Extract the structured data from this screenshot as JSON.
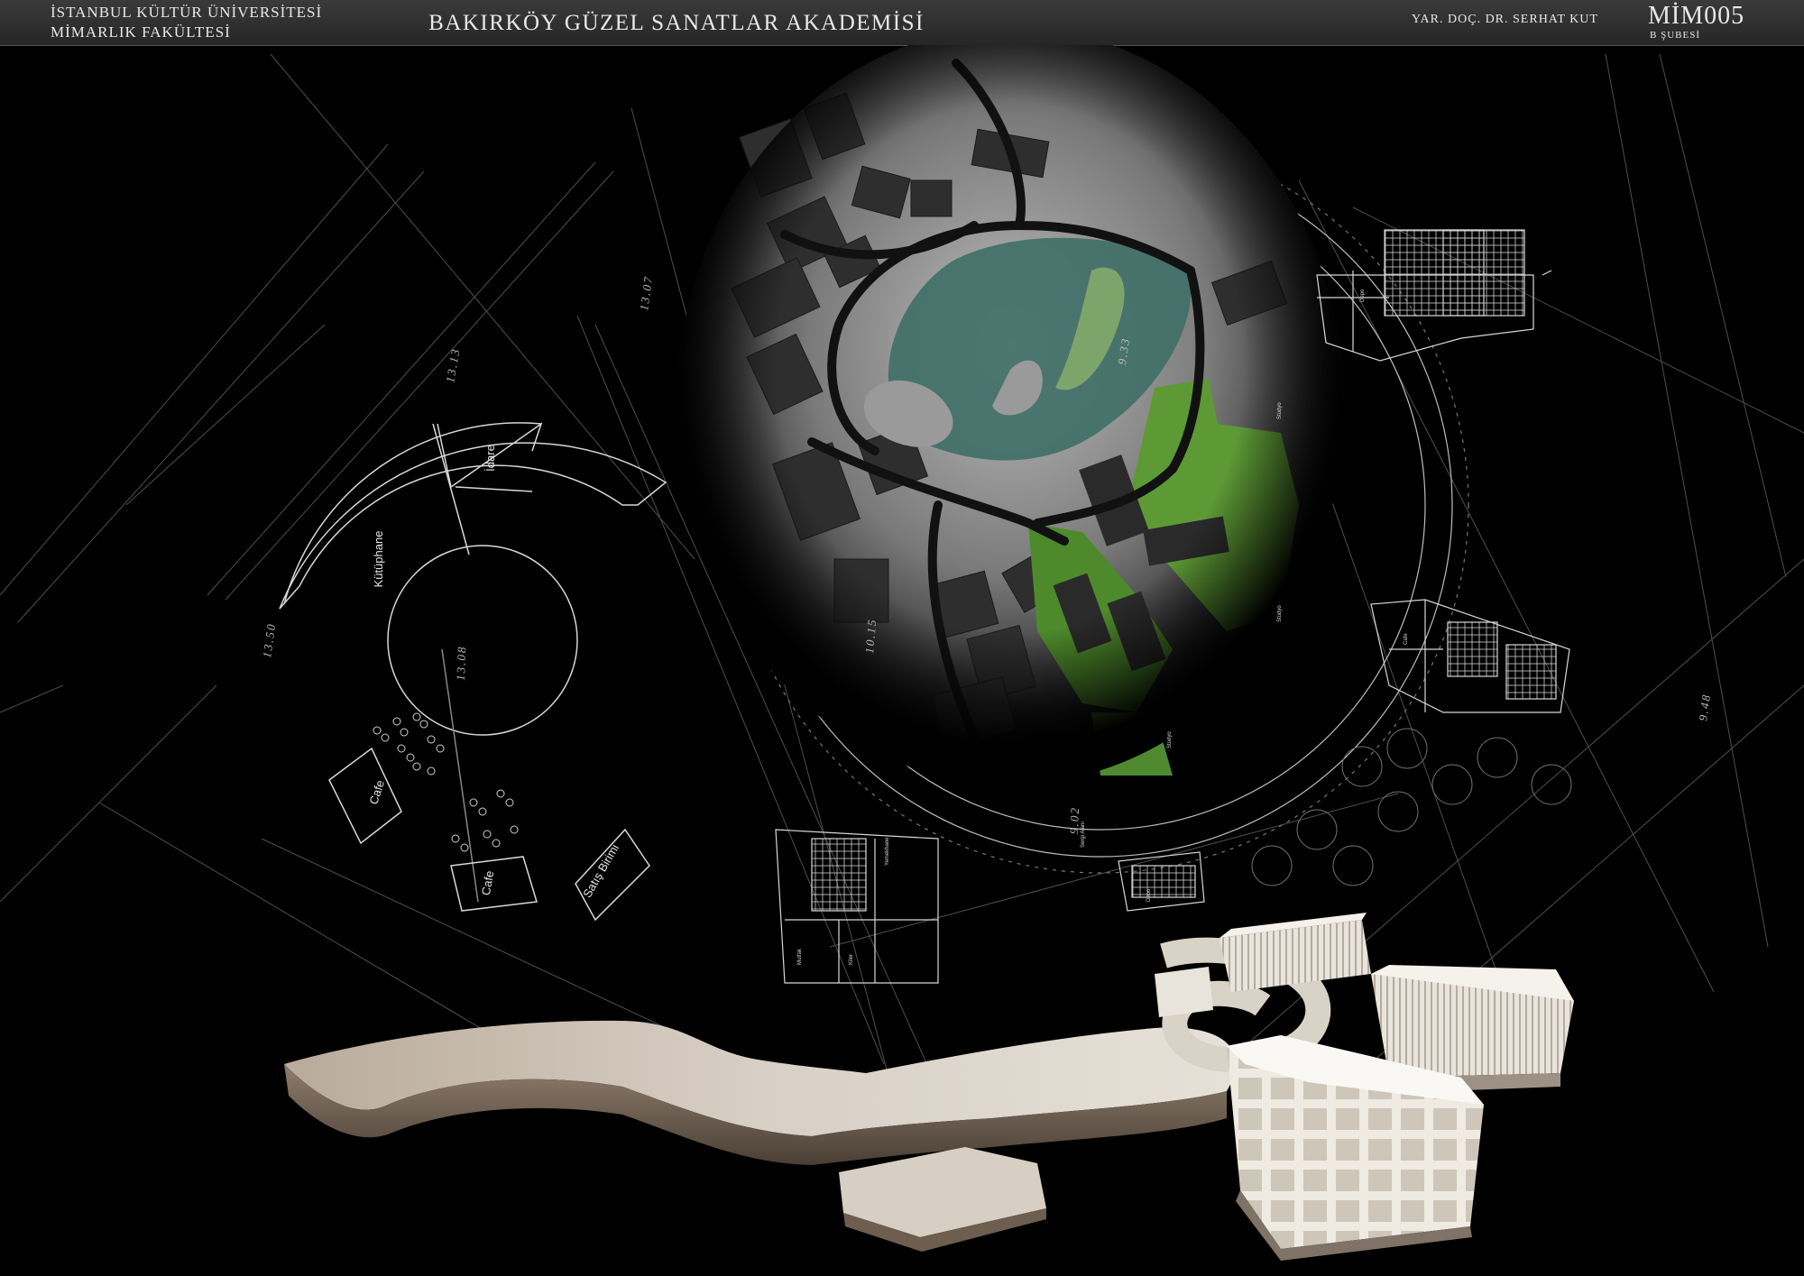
{
  "header": {
    "university": "İSTANBUL KÜLTÜR ÜNİVERSİTESİ",
    "faculty": "MİMARLIK FAKÜLTESİ",
    "project_title": "BAKIRKÖY GÜZEL SANATLAR AKADEMİSİ",
    "instructor": "YAR. DOÇ. DR. SERHAT KUT",
    "course_code": "MİM005",
    "section": "B ŞUBESİ"
  },
  "plan": {
    "rooms": {
      "kutuphane": "Kütüphane",
      "idare": "İdare",
      "cafe_1": "Cafe",
      "cafe_2": "Cafe",
      "satis": "Satış Birimi"
    },
    "dimensions": {
      "d1313": "13.13",
      "d1307": "13.07",
      "d1350": "13.50",
      "d1308": "13.08",
      "d933": "9.33",
      "d1015": "10.15",
      "d902": "9.02",
      "d948": "9.48"
    },
    "small_labels": {
      "depo": "Depo",
      "studyo_1": "Stüdyo",
      "studyo_2": "Stüdyo",
      "studyo_3": "Stüdyo",
      "cafe_small": "Cafe",
      "sergi": "Sergi Alanı",
      "yemekhane": "Yemekhane",
      "mutfak": "Mutfak",
      "kiler": "Kiler",
      "depo_2": "Depo"
    }
  },
  "colors": {
    "background": "#000000",
    "linework": "#cfcfcf",
    "green": "#5d9a35",
    "teal": "#3f6f67",
    "model": "#c9bfb2"
  }
}
